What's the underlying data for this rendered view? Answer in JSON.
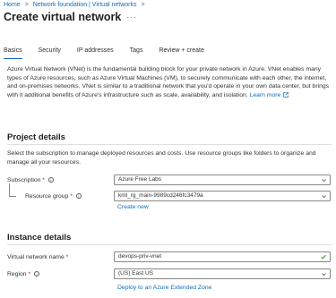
{
  "breadcrumb": {
    "items": [
      "Home",
      "Network foundation | Virtual networks"
    ]
  },
  "page": {
    "title": "Create virtual network",
    "more_label": "···"
  },
  "tabs": [
    {
      "label": "Basics",
      "active": true
    },
    {
      "label": "Security",
      "active": false
    },
    {
      "label": "IP addresses",
      "active": false
    },
    {
      "label": "Tags",
      "active": false
    },
    {
      "label": "Review + create",
      "active": false
    }
  ],
  "intro": {
    "text": "Azure Virtual Network (VNet) is the fundamental building block for your private network in Azure. VNet enables many types of Azure resources, such as Azure Virtual Machines (VM), to securely communicate with each other, the internet, and on-premises networks. VNet is similar to a traditional network that you'd operate in your own data center, but brings with it additional benefits of Azure's infrastructure such as scale, availability, and isolation.",
    "learn_more": "Learn more"
  },
  "project": {
    "heading": "Project details",
    "description": "Select the subscription to manage deployed resources and costs. Use resource groups like folders to organize and manage all your resources.",
    "subscription_label": "Subscription",
    "subscription_value": "Azure Free Labs",
    "resource_group_label": "Resource group",
    "resource_group_value": "kml_rg_main-9989cd246fc3479a",
    "create_new": "Create new"
  },
  "instance": {
    "heading": "Instance details",
    "vnet_name_label": "Virtual network name",
    "vnet_name_value": "devops-priv-vnet",
    "region_label": "Region",
    "region_value": "(US) East US",
    "extended_zone_link": "Deploy to an Azure Extended Zone"
  },
  "required_marker": "*",
  "colors": {
    "accent": "#0f6cbd",
    "required": "#a4262c",
    "text": "#323130"
  }
}
